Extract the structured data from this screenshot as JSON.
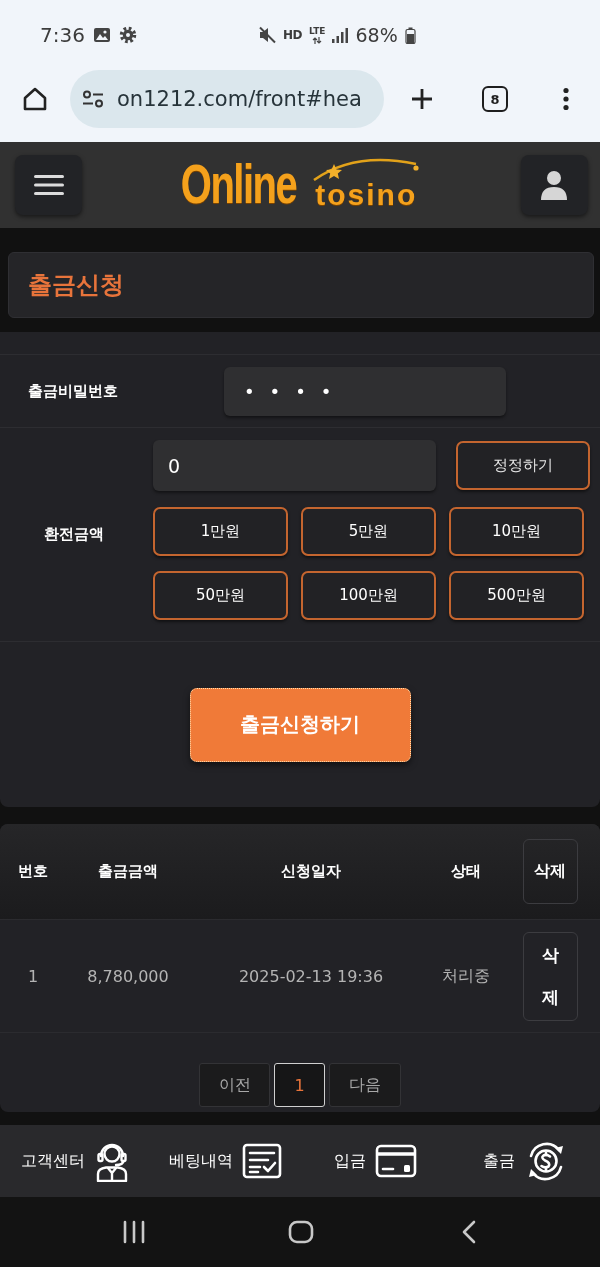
{
  "status_bar": {
    "time": "7:36",
    "hd_label": "HD",
    "lte_label": "LTE",
    "battery_text": "68%"
  },
  "browser_bar": {
    "url": "on1212.com/front#hea",
    "tab_count": "8"
  },
  "site_header": {
    "logo": [
      "Online",
      "tosino"
    ]
  },
  "page_title": "출금신청",
  "withdraw_form": {
    "password": {
      "label": "출금비밀번호",
      "value": "••••"
    },
    "amount": {
      "label": "환전금액",
      "value": "0",
      "reset_button": "정정하기",
      "quick_amounts": [
        "1만원",
        "5만원",
        "10만원",
        "50만원",
        "100만원",
        "500만원"
      ]
    },
    "submit_button": "출금신청하기"
  },
  "history_table": {
    "columns": [
      {
        "label": "번호",
        "kind": "text"
      },
      {
        "label": "출금금액",
        "kind": "text"
      },
      {
        "label": "신청일자",
        "kind": "text"
      },
      {
        "label": "상태",
        "kind": "text"
      },
      {
        "label": "삭제",
        "kind": "button"
      }
    ],
    "rows": [
      {
        "cells": [
          "1",
          "8,780,000",
          "2025-02-13 19:36",
          "처리중",
          "삭제"
        ]
      }
    ]
  },
  "pagination": {
    "previous": "이전",
    "pages": [
      {
        "label": "1",
        "selected": true
      }
    ],
    "next": "다음"
  },
  "bottom_nav": [
    {
      "label": "고객센터"
    },
    {
      "label": "베팅내역"
    },
    {
      "label": "입금"
    },
    {
      "label": "출금"
    }
  ]
}
